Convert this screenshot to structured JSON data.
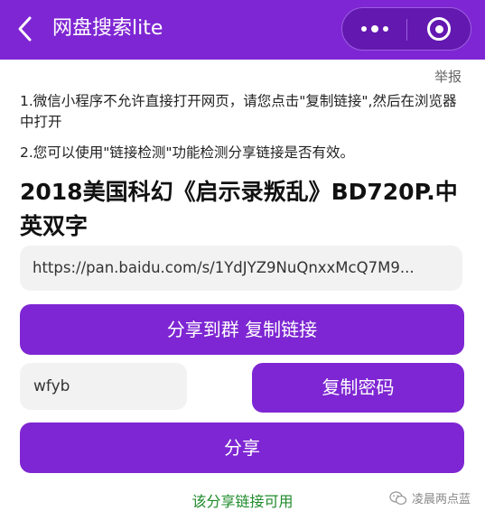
{
  "header": {
    "title": "网盘搜索lite",
    "back_icon": "chevron-left-icon",
    "more_icon": "more-dots-icon",
    "close_icon": "target-close-icon",
    "color": "#7e26d3"
  },
  "report_link": "举报",
  "notices": [
    "1.微信小程序不允许直接打开网页，请您点击\"复制链接\",然后在浏览器中打开",
    "2.您可以使用\"链接检测\"功能检测分享链接是否有效。"
  ],
  "resource": {
    "title": "2018美国科幻《启示录叛乱》BD720P.中英双字",
    "link": "https://pan.baidu.com/s/1YdJYZ9NuQnxxMcQ7M9..."
  },
  "buttons": {
    "share_group_copy_link": "分享到群 复制链接",
    "copy_password": "复制密码",
    "share": "分享"
  },
  "password": "wfyb",
  "status": {
    "text": "该分享链接可用",
    "color": "#1e8a2a"
  },
  "watermark": {
    "text": "凌晨两点蓝",
    "icon": "wechat-logo-icon"
  }
}
